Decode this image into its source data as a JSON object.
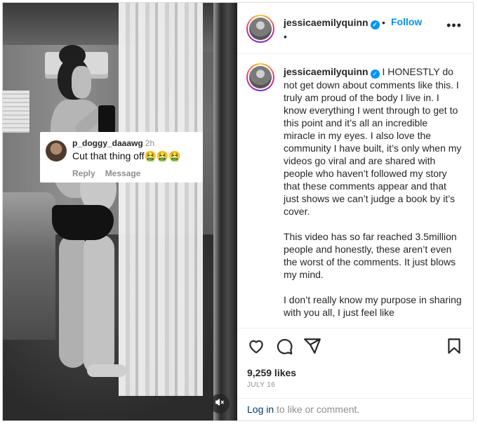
{
  "post": {
    "author": "jessicaemilyquinn",
    "follow_label": "Follow",
    "separator": "•",
    "location_dot": "•",
    "more_label": "•••"
  },
  "overlay_comment": {
    "username": "p_doggy_daaawg",
    "time": "2h",
    "text": "Cut that thing off🤮🤮🤮",
    "reply_label": "Reply",
    "message_label": "Message"
  },
  "caption": {
    "username": "jessicaemilyquinn",
    "paragraph_1": "I HONESTLY do not get down about comments like this. I truly am proud of the body I live in. I know everything I went through to get to this point and it’s all an incredible miracle in my eyes. I also love the community I have built, it’s only when my videos go viral and are shared with people who haven’t followed my story that these comments appear and that just shows we can’t judge a book by it’s cover.",
    "paragraph_2": "This video has so far reached 3.5million people and honestly, these aren’t even the worst of the comments. It just blows my mind.",
    "paragraph_3": "I don’t really know my purpose in sharing with you all, I just feel like"
  },
  "stats": {
    "likes": "9,259 likes",
    "date": "JULY 16"
  },
  "login": {
    "link": "Log in",
    "rest": " to like or comment."
  },
  "icons": {
    "like": "heart-icon",
    "comment": "comment-icon",
    "share": "paper-plane-icon",
    "save": "bookmark-icon",
    "mute": "speaker-muted-icon",
    "verified": "verified-badge-icon"
  },
  "colors": {
    "accent": "#0095f6",
    "text": "#262626",
    "muted": "#8e8e8e",
    "link": "#00376b"
  }
}
